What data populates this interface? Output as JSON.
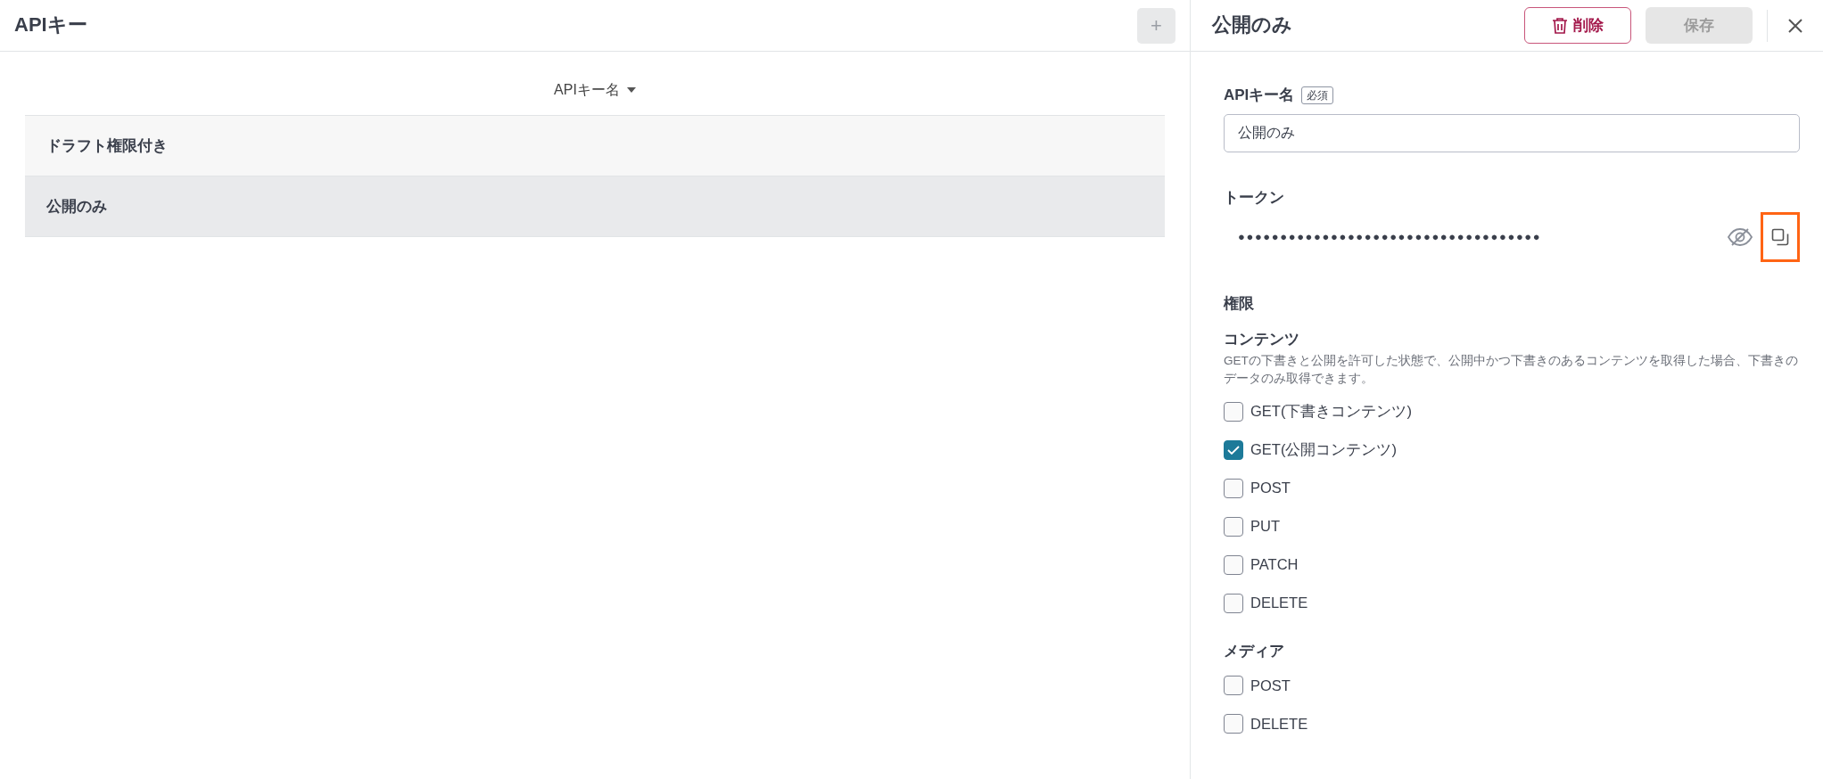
{
  "list_panel": {
    "title": "APIキー",
    "add_button": {
      "label": "+",
      "disabled": true
    },
    "sort_header": {
      "label": "APIキー名"
    },
    "rows": [
      {
        "name": "ドラフト権限付き",
        "selected": false
      },
      {
        "name": "公開のみ",
        "selected": true
      }
    ]
  },
  "detail_panel": {
    "title": "公開のみ",
    "delete_button": {
      "label": "削除"
    },
    "save_button": {
      "label": "保存",
      "disabled": true
    },
    "name_field": {
      "label": "APIキー名",
      "required_badge": "必須",
      "value": "公開のみ"
    },
    "token": {
      "label": "トークン",
      "masked_value": "●●●●●●●●●●●●●●●●●●●●●●●●●●●●●●●●●●●●",
      "copy_highlighted": true
    },
    "permissions": {
      "title": "権限",
      "groups": [
        {
          "title": "コンテンツ",
          "description": "GETの下書きと公開を許可した状態で、公開中かつ下書きのあるコンテンツを取得した場合、下書きのデータのみ取得できます。",
          "options": [
            {
              "label": "GET(下書きコンテンツ)",
              "checked": false
            },
            {
              "label": "GET(公開コンテンツ)",
              "checked": true
            },
            {
              "label": "POST",
              "checked": false
            },
            {
              "label": "PUT",
              "checked": false
            },
            {
              "label": "PATCH",
              "checked": false
            },
            {
              "label": "DELETE",
              "checked": false
            }
          ]
        },
        {
          "title": "メディア",
          "options": [
            {
              "label": "POST",
              "checked": false
            },
            {
              "label": "DELETE",
              "checked": false
            }
          ]
        }
      ]
    }
  }
}
